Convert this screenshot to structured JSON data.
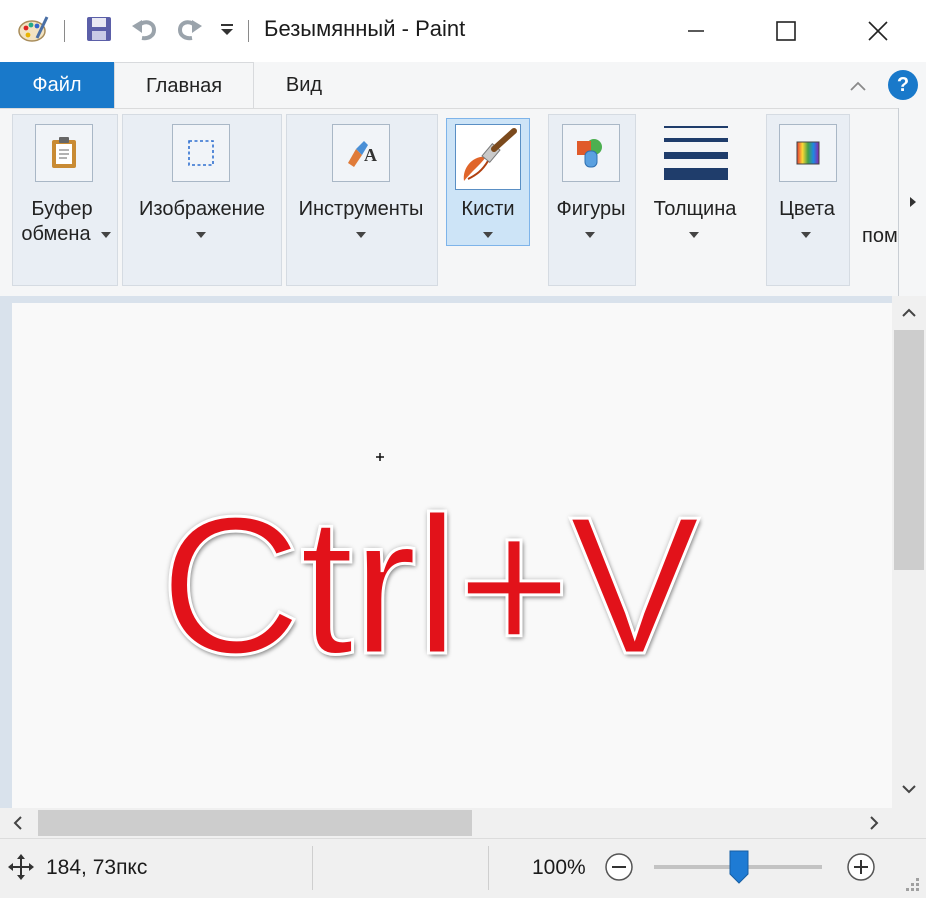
{
  "window": {
    "title": "Безымянный - Paint",
    "buttons": [
      "minimize",
      "maximize",
      "close"
    ]
  },
  "quick_access": {
    "icons": [
      "paint-app-icon",
      "save-icon",
      "undo-icon",
      "redo-icon",
      "customize-dropdown-icon"
    ]
  },
  "tabs": [
    {
      "label": "Файл"
    },
    {
      "label": "Главная"
    },
    {
      "label": "Вид"
    }
  ],
  "ribbon": {
    "groups": [
      {
        "label1": "Буфер",
        "label2": "обмена"
      },
      {
        "label": "Изображение"
      },
      {
        "label": "Инструменты"
      },
      {
        "label": "Кисти"
      },
      {
        "label": "Фигуры"
      },
      {
        "label": "Толщина"
      },
      {
        "label": "Цвета"
      },
      {
        "label": "пом"
      }
    ]
  },
  "canvas": {
    "text": "Ctrl+V",
    "text_color": "#e2121a"
  },
  "status": {
    "coordinates": "184, 73пкс",
    "zoom": "100%",
    "zoom_level_percent": 100
  },
  "colors": {
    "file_tab": "#1979ca",
    "active_group": "#cde4f7",
    "help": "#1979ca"
  }
}
